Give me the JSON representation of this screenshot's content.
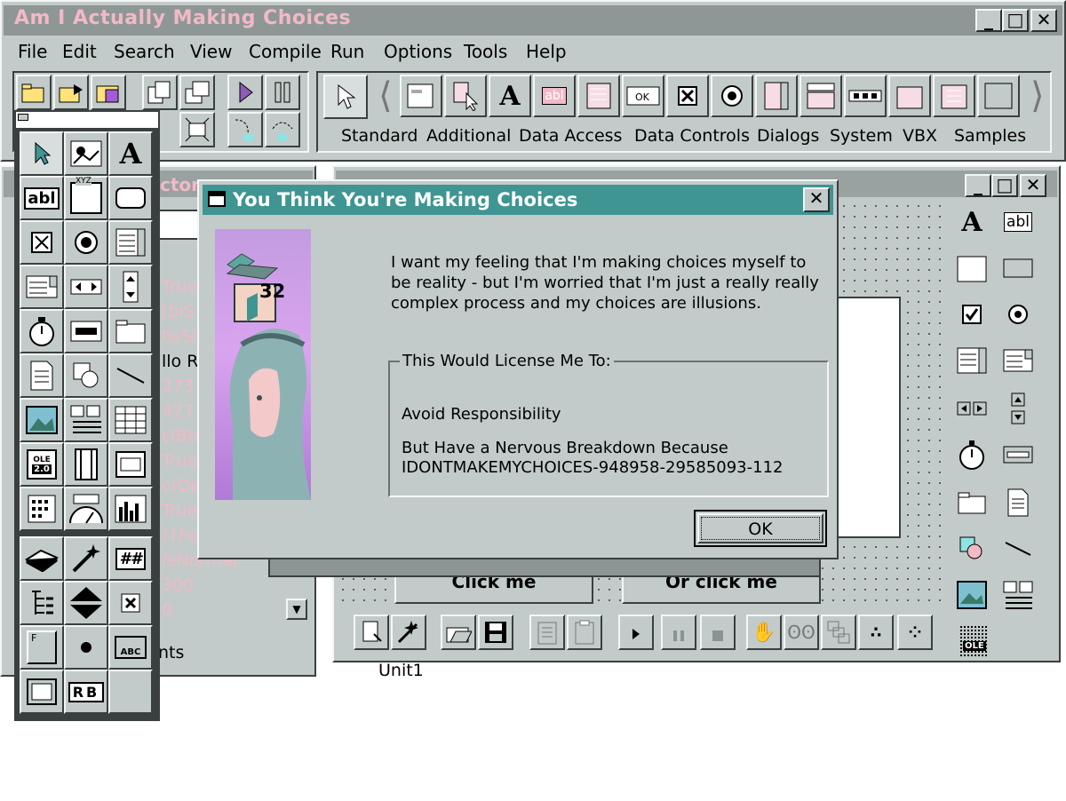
{
  "main_window": {
    "title": "Am I Actually Making Choices",
    "min_glyph": "_",
    "max_glyph": "□",
    "close_glyph": "✕"
  },
  "menu": [
    "File",
    "Edit",
    "Search",
    "View",
    "Compile",
    "Run",
    "Options",
    "Tools",
    "Help"
  ],
  "component_tabs": [
    "Standard",
    "Additional",
    "Data Access",
    "Data Controls",
    "Dialogs",
    "System",
    "VBX",
    "Samples"
  ],
  "object_inspector": {
    "title_fragment": "ctor",
    "values": [
      "True",
      "[biS",
      "bsSi",
      "llo R",
      "273",
      "427",
      "clBtn",
      "True",
      "crDe",
      "True",
      "(TFo",
      "fsNormal",
      "300",
      "0"
    ],
    "tab_fragment": "nts"
  },
  "form_window": {
    "button1": "Click me",
    "button2": "Or click me",
    "tab": "Unit1"
  },
  "dialog": {
    "title": "You Think You're Making Choices",
    "message": "I want my feeling that I'm making choices myself to be reality - but I'm worried that I'm just a really really complex process and my choices are illusions.",
    "group_label": "This Would License Me To:",
    "option1": "Avoid Responsibility",
    "option2_line1": "But Have a Nervous Breakdown Because",
    "option2_line2": "IDONTMAKEMYCHOICES-948958-29585093-112",
    "ok_label": "OK",
    "badge": "32"
  },
  "palette_labels": {
    "abl": "abl",
    "xyz": "XYZ",
    "ole": "OLE",
    "ole_version": "2.0",
    "abc": "ABC",
    "rb": "RB",
    "hash": "##",
    "f": "F"
  },
  "colors": {
    "face": "#c2cbc9",
    "titlebar_active": "#3e9592",
    "title_text_main": "#f2b9c7",
    "pink_text": "#f2b9c7",
    "desktop": "#ffffff"
  }
}
